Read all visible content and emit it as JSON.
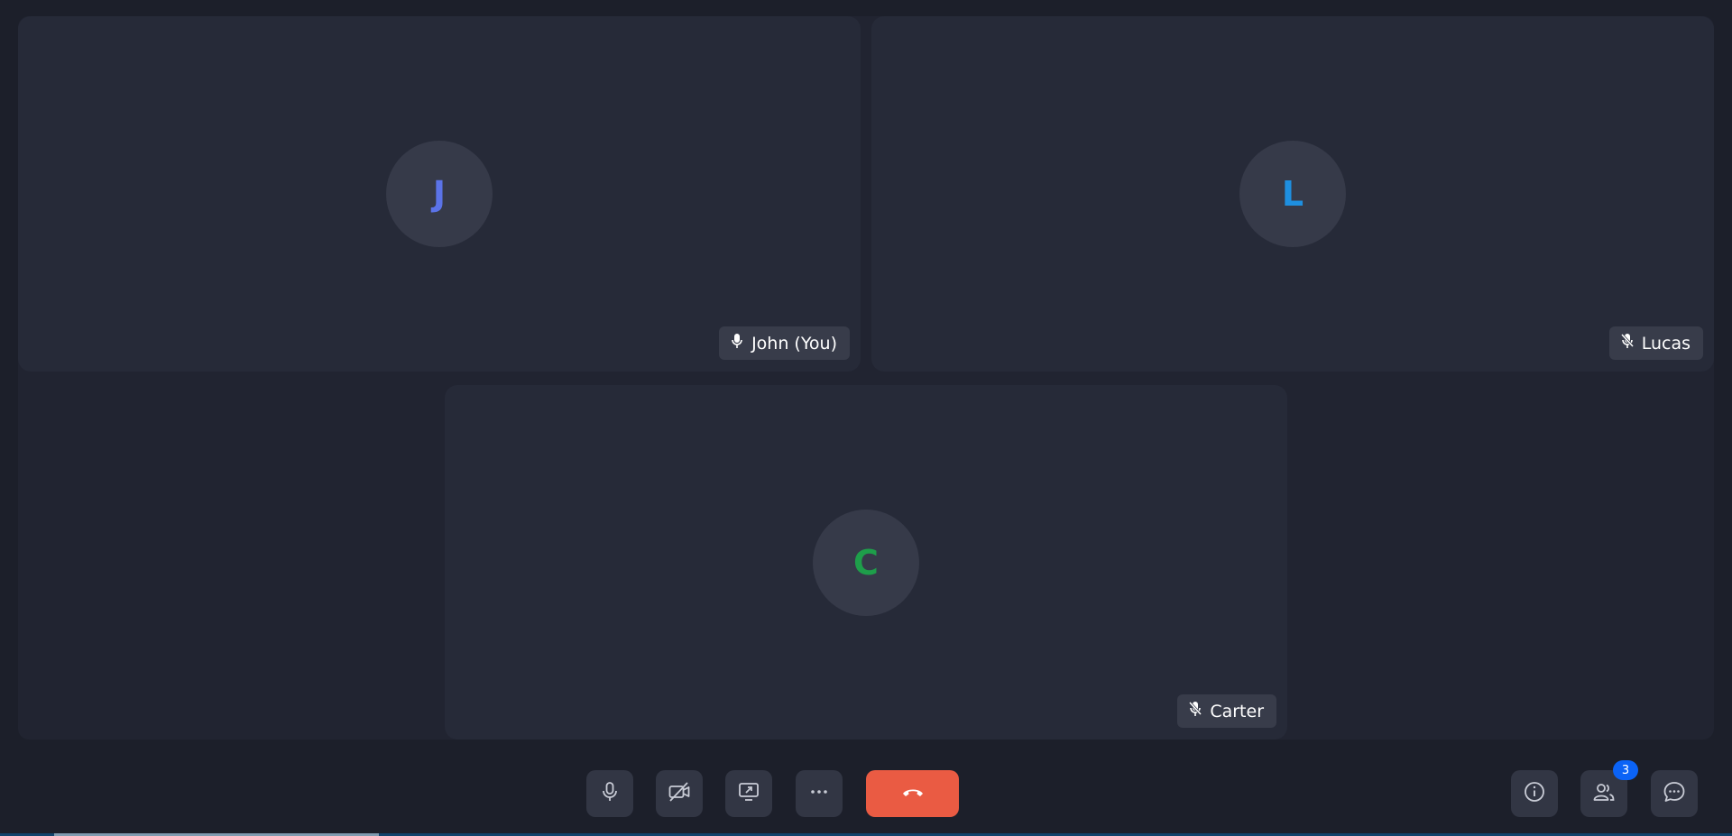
{
  "participants": [
    {
      "initial": "J",
      "name": "John (You)",
      "mic": "mic-on-icon",
      "avatar_color": "#5b73e8"
    },
    {
      "initial": "L",
      "name": "Lucas",
      "mic": "mic-off-icon",
      "avatar_color": "#1e8fe0"
    },
    {
      "initial": "C",
      "name": "Carter",
      "mic": "mic-off-icon",
      "avatar_color": "#1e9e4a"
    }
  ],
  "toolbar": {
    "mic": "microphone-icon",
    "camera": "camera-off-icon",
    "share": "screen-share-icon",
    "more": "more-options-icon",
    "hangup": "hang-up-icon",
    "info": "info-icon",
    "people": "participants-icon",
    "people_count": "3",
    "chat": "chat-icon"
  },
  "colors": {
    "background": "#1c1f2a",
    "tile": "#262a38",
    "hangup": "#ea5b43",
    "badge": "#0b63f6"
  }
}
